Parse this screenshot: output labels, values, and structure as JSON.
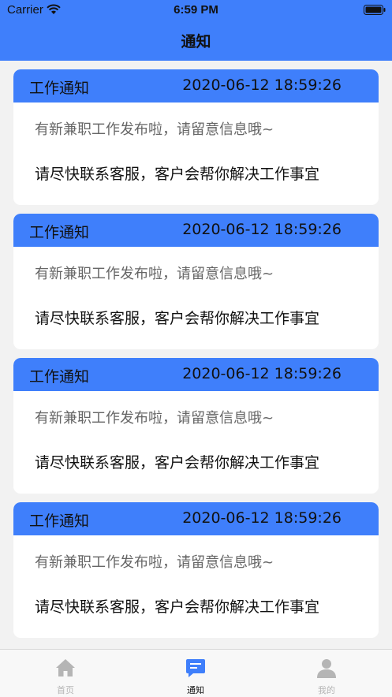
{
  "status": {
    "carrier": "Carrier",
    "time": "6:59 PM"
  },
  "header": {
    "title": "通知"
  },
  "notifications": [
    {
      "title": "工作通知",
      "date": "2020-06-12 18:59:26",
      "subtitle": "有新兼职工作发布啦，请留意信息哦~",
      "body": "请尽快联系客服，客户会帮你解决工作事宜"
    },
    {
      "title": "工作通知",
      "date": "2020-06-12 18:59:26",
      "subtitle": "有新兼职工作发布啦，请留意信息哦~",
      "body": "请尽快联系客服，客户会帮你解决工作事宜"
    },
    {
      "title": "工作通知",
      "date": "2020-06-12 18:59:26",
      "subtitle": "有新兼职工作发布啦，请留意信息哦~",
      "body": "请尽快联系客服，客户会帮你解决工作事宜"
    },
    {
      "title": "工作通知",
      "date": "2020-06-12 18:59:26",
      "subtitle": "有新兼职工作发布啦，请留意信息哦~",
      "body": "请尽快联系客服，客户会帮你解决工作事宜"
    }
  ],
  "tabs": [
    {
      "label": "首页",
      "icon": "home-icon"
    },
    {
      "label": "通知",
      "icon": "message-icon"
    },
    {
      "label": "我的",
      "icon": "user-icon"
    }
  ],
  "colors": {
    "accent": "#3f7ffb",
    "tab_active": "#3f7ffb",
    "tab_inactive": "#b5b5b5"
  }
}
